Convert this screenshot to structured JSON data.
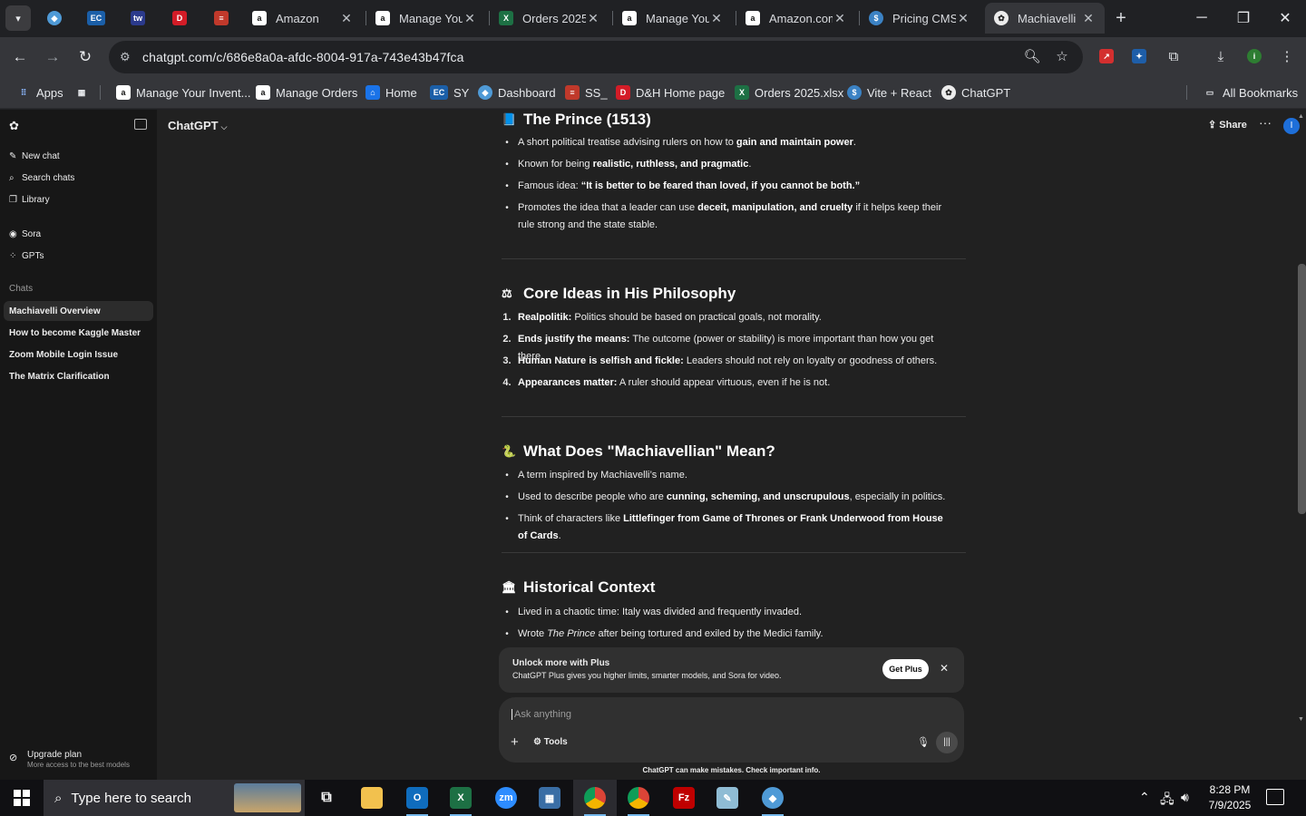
{
  "browser": {
    "tabs": [
      {
        "label": "Amazon",
        "icon": "amazon-icon"
      },
      {
        "label": "Manage Your",
        "icon": "amazon-icon"
      },
      {
        "label": "Orders 2025",
        "icon": "excel-icon"
      },
      {
        "label": "Manage Your",
        "icon": "amazon-icon"
      },
      {
        "label": "Amazon.com",
        "icon": "amazon-icon"
      },
      {
        "label": "Pricing CMS",
        "icon": "dollar-icon"
      },
      {
        "label": "Machiavelli",
        "icon": "chatgpt-icon",
        "active": true
      }
    ],
    "url": "chatgpt.com/c/686e8a0a-afdc-8004-917a-743e43b47fca",
    "bookmarks": {
      "apps": "Apps",
      "items": [
        {
          "label": "Manage Your Invent...",
          "icon": "amazon-icon"
        },
        {
          "label": "Manage Orders",
          "icon": "amazon-icon"
        },
        {
          "label": "Home",
          "icon": "home-icon"
        },
        {
          "label": "SY",
          "icon": "ec-icon"
        },
        {
          "label": "Dashboard",
          "icon": "dashboard-icon"
        },
        {
          "label": "SS_",
          "icon": "layers-icon"
        },
        {
          "label": "D&H Home page",
          "icon": "dh-icon"
        },
        {
          "label": "Orders 2025.xlsx",
          "icon": "excel-icon"
        },
        {
          "label": "Vite + React",
          "icon": "dollar-icon"
        },
        {
          "label": "ChatGPT",
          "icon": "chatgpt-icon"
        }
      ],
      "all": "All Bookmarks"
    },
    "colors": {
      "chrome_bg": "#202124",
      "toolbar": "#35363a"
    }
  },
  "sidebar": {
    "items": [
      {
        "label": "New chat",
        "icon": "edit-icon"
      },
      {
        "label": "Search chats",
        "icon": "search-icon"
      },
      {
        "label": "Library",
        "icon": "library-icon"
      },
      {
        "label": "Sora",
        "icon": "sora-icon"
      },
      {
        "label": "GPTs",
        "icon": "grid-icon"
      }
    ],
    "chats_header": "Chats",
    "chats": [
      {
        "label": "Machiavelli Overview",
        "active": true
      },
      {
        "label": "How to become Kaggle Master"
      },
      {
        "label": "Zoom Mobile Login Issue"
      },
      {
        "label": "The Matrix Clarification"
      }
    ],
    "upgrade": {
      "title": "Upgrade plan",
      "subtitle": "More access to the best models"
    }
  },
  "header": {
    "model": "ChatGPT",
    "share": "Share",
    "avatar": "I"
  },
  "article": {
    "s1": {
      "emoji": "📘",
      "title": "The Prince (1513)",
      "items": [
        {
          "a": "A short political treatise advising rulers on how to ",
          "b": "gain and maintain power",
          "c": "."
        },
        {
          "a": "Known for being ",
          "b": "realistic, ruthless, and pragmatic",
          "c": "."
        },
        {
          "a": "Famous idea: ",
          "b": "“It is better to be feared than loved, if you cannot be both.”",
          "c": ""
        },
        {
          "a": "Promotes the idea that a leader can use ",
          "b": "deceit, manipulation, and cruelty",
          "c": " if it helps keep their rule strong and the state stable."
        }
      ]
    },
    "s2": {
      "emoji": "⚖",
      "title": "Core Ideas in His Philosophy",
      "items": [
        {
          "n": "1.",
          "b": "Realpolitik:",
          "c": " Politics should be based on practical goals, not morality."
        },
        {
          "n": "2.",
          "b": "Ends justify the means:",
          "c": " The outcome (power or stability) is more important than how you get there."
        },
        {
          "n": "3.",
          "b": "Human Nature is selfish and fickle:",
          "c": " Leaders should not rely on loyalty or goodness of others."
        },
        {
          "n": "4.",
          "b": "Appearances matter:",
          "c": " A ruler should appear virtuous, even if he is not."
        }
      ]
    },
    "s3": {
      "emoji": "🐍",
      "title": "What Does \"Machiavellian\" Mean?",
      "items": [
        {
          "a": "A term inspired by Machiavelli’s name.",
          "b": "",
          "c": ""
        },
        {
          "a": "Used to describe people who are ",
          "b": "cunning, scheming, and unscrupulous",
          "c": ", especially in politics."
        },
        {
          "a": "Think of characters like ",
          "b": "Littlefinger from Game of Thrones or Frank Underwood from House of Cards",
          "c": "."
        }
      ]
    },
    "s4": {
      "emoji": "🏛",
      "title": "Historical Context",
      "items": [
        {
          "a": "Lived in a chaotic time: Italy was divided and frequently invaded.",
          "i": "",
          "c": ""
        },
        {
          "a": "Wrote ",
          "i": "The Prince",
          "c": " after being tortured and exiled by the Medici family."
        }
      ]
    }
  },
  "promo": {
    "title": "Unlock more with Plus",
    "subtitle": "ChatGPT Plus gives you higher limits, smarter models, and Sora for video.",
    "button": "Get Plus"
  },
  "composer": {
    "placeholder": "Ask anything",
    "tools": "Tools"
  },
  "disclaimer": "ChatGPT can make mistakes. Check important info.",
  "taskbar": {
    "search_placeholder": "Type here to search",
    "apps": [
      "task-view-icon",
      "file-explorer-icon",
      "outlook-icon",
      "excel-icon",
      "zoom-icon",
      "calculator-icon",
      "chrome-icon",
      "chrome-icon",
      "filezilla-icon",
      "notes-icon",
      "app-icon"
    ],
    "time": "8:28 PM",
    "date": "7/9/2025"
  }
}
